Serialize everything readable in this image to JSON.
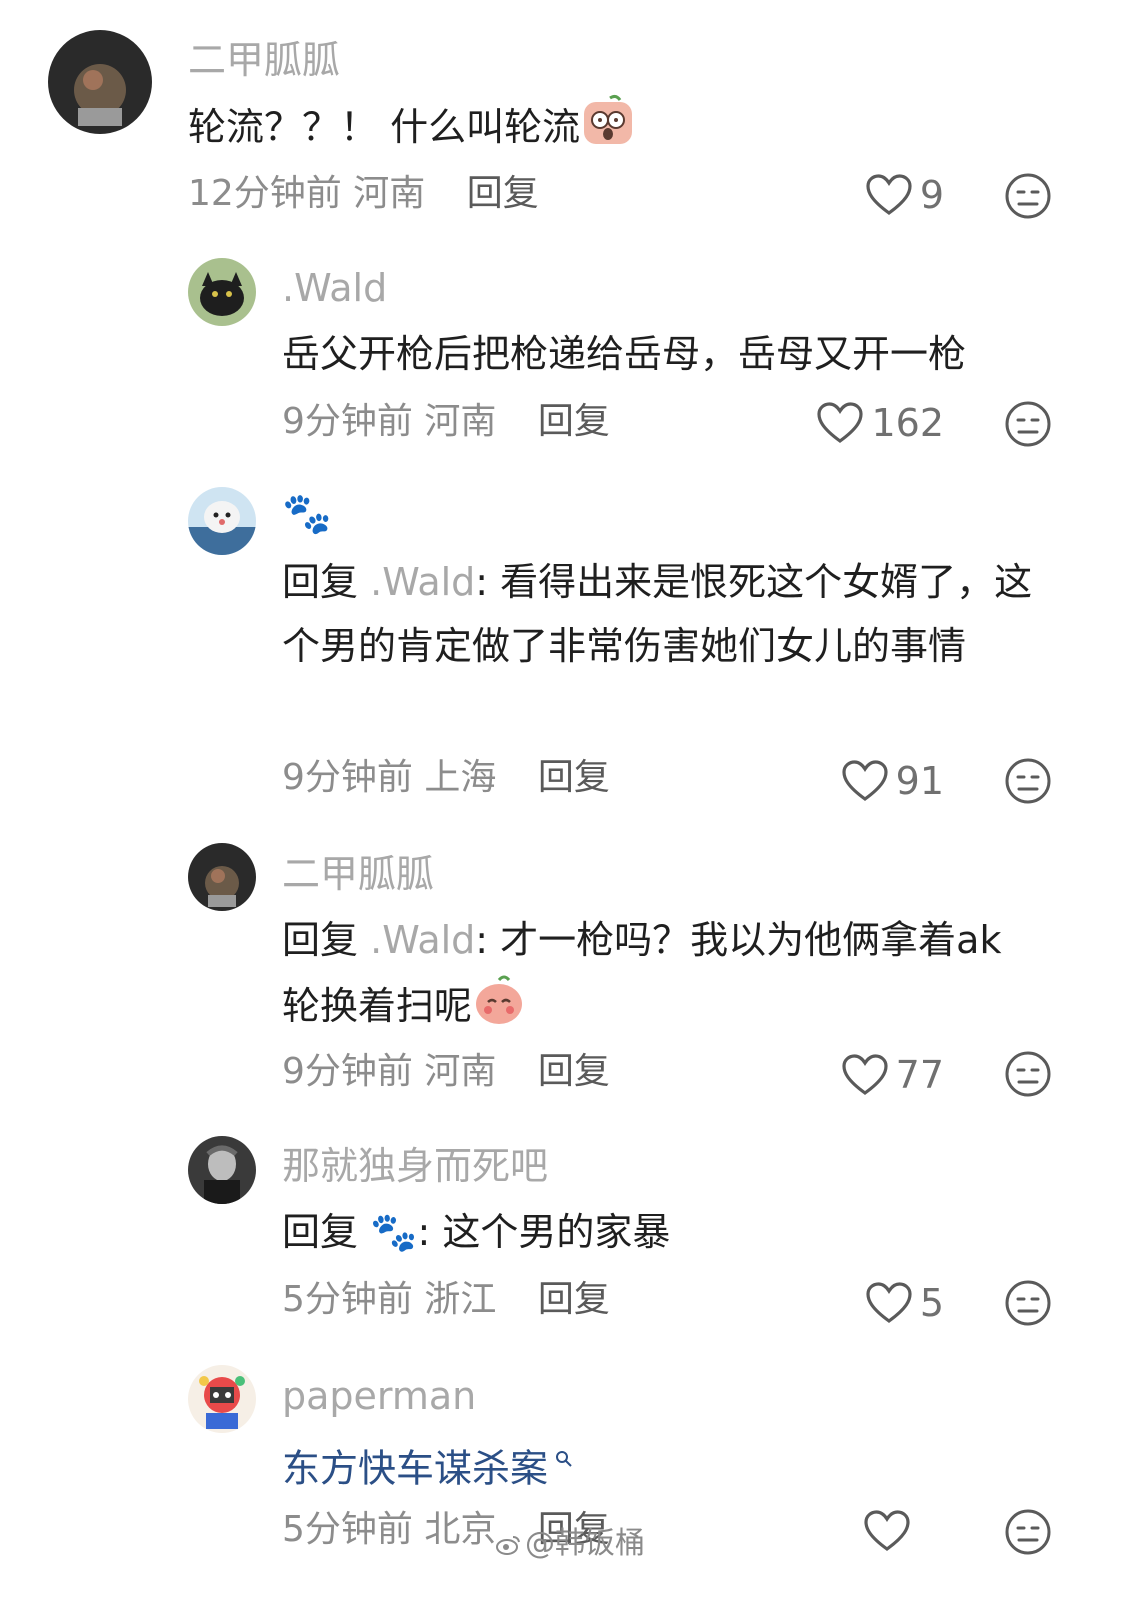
{
  "comments": [
    {
      "username": "二甲胍胍",
      "text": "轮流？？！ 什么叫轮流",
      "time": "12分钟前",
      "location": "河南",
      "reply_label": "回复",
      "likes": "9"
    },
    {
      "username": ".Wald",
      "text": "岳父开枪后把枪递给岳母，岳母又开一枪",
      "time": "9分钟前",
      "location": "河南",
      "reply_label": "回复",
      "likes": "162"
    },
    {
      "username": "🐾",
      "reply_prefix": "回复",
      "reply_target": ".Wald",
      "text": ": 看得出来是恨死这个女婿了，这个男的肯定做了非常伤害她们女儿的事情",
      "time": "9分钟前",
      "location": "上海",
      "reply_label": "回复",
      "likes": "91"
    },
    {
      "username": "二甲胍胍",
      "reply_prefix": "回复",
      "reply_target": ".Wald",
      "text": ": 才一枪吗？我以为他俩拿着ak 轮换着扫呢",
      "time": "9分钟前",
      "location": "河南",
      "reply_label": "回复",
      "likes": "77"
    },
    {
      "username": "那就独身而死吧",
      "reply_prefix": "回复",
      "reply_target": "🐾",
      "text": ": 这个男的家暴",
      "time": "5分钟前",
      "location": "浙江",
      "reply_label": "回复",
      "likes": "5"
    },
    {
      "username": "paperman",
      "text": "东方快车谋杀案",
      "time": "5分钟前",
      "location": "北京",
      "reply_label": "回复",
      "likes": ""
    }
  ],
  "watermark": "@韩饭桶",
  "icons": {
    "like": "heart-outline-icon",
    "dislike": "neutral-face-icon",
    "search": "search-icon"
  }
}
